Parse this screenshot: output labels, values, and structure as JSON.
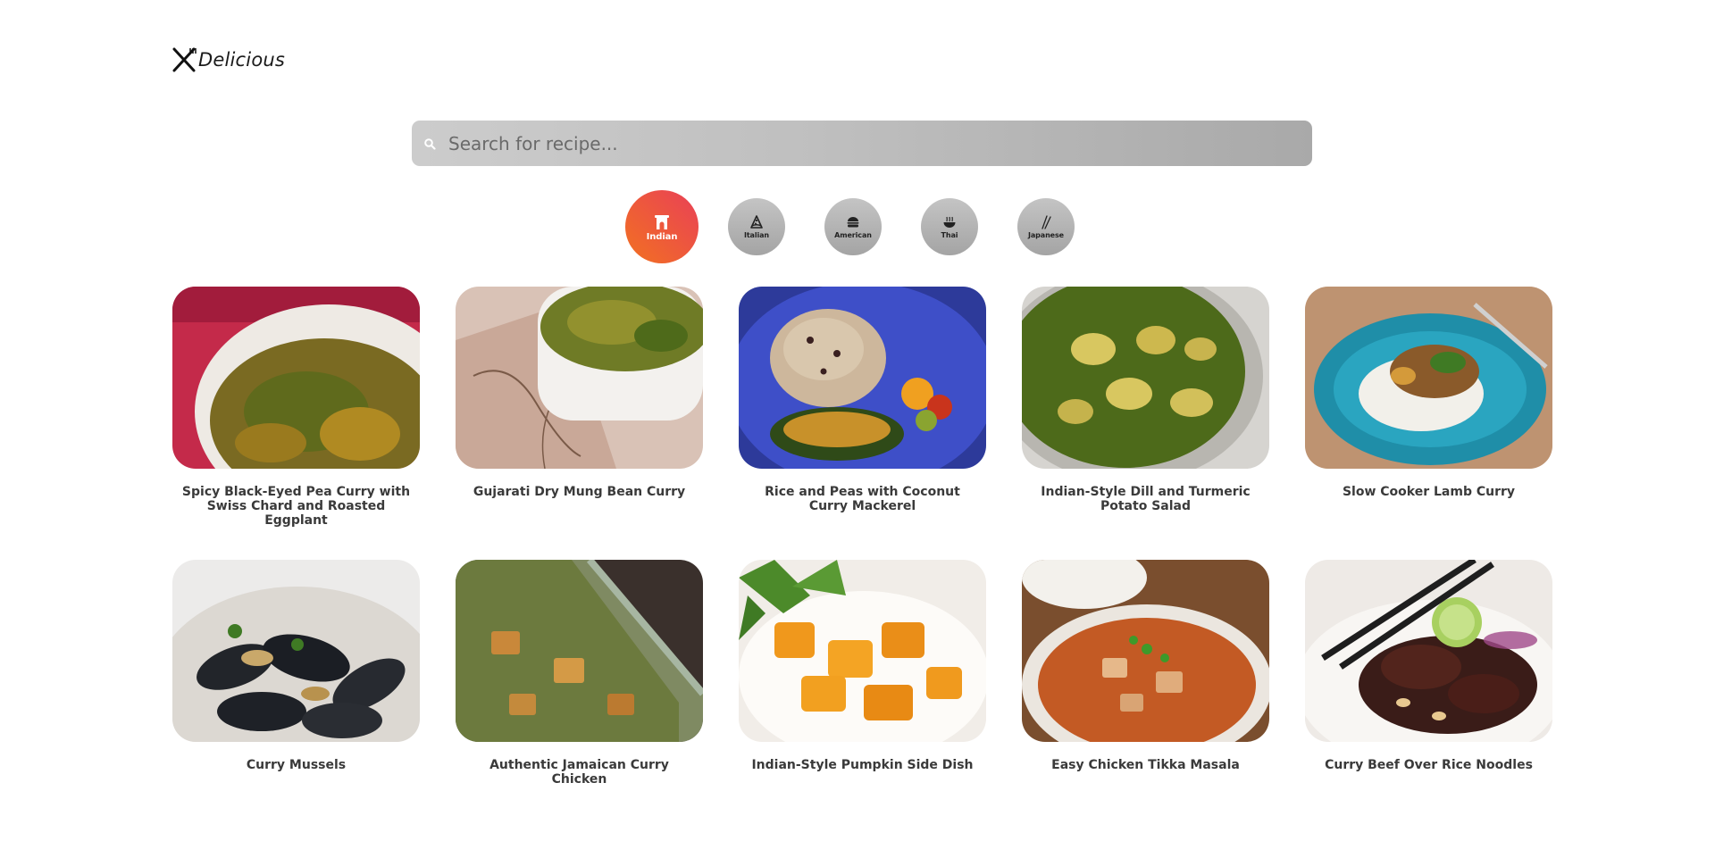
{
  "header": {
    "logo_text": "Delicious",
    "logo_icon": "fork-knife-crossed-icon"
  },
  "search": {
    "placeholder": "Search for recipe...",
    "value": "",
    "icon": "search-icon"
  },
  "categories": [
    {
      "label": "Indian",
      "icon": "india-gate-icon",
      "active": true
    },
    {
      "label": "Italian",
      "icon": "pizza-icon",
      "active": false
    },
    {
      "label": "American",
      "icon": "burger-icon",
      "active": false
    },
    {
      "label": "Thai",
      "icon": "noodle-bowl-icon",
      "active": false
    },
    {
      "label": "Japanese",
      "icon": "chopsticks-icon",
      "active": false
    }
  ],
  "colors": {
    "accent_start": "#f27121",
    "accent_end": "#e94057",
    "inactive_category": "#b4b4b4",
    "title_text": "#3a3a3a"
  },
  "recipes": [
    {
      "title": "Spicy Black-Eyed Pea Curry with Swiss Chard and Roasted Eggplant"
    },
    {
      "title": "Gujarati Dry Mung Bean Curry"
    },
    {
      "title": "Rice and Peas with Coconut Curry Mackerel"
    },
    {
      "title": "Indian-Style Dill and Turmeric Potato Salad"
    },
    {
      "title": "Slow Cooker Lamb Curry"
    },
    {
      "title": "Curry Mussels"
    },
    {
      "title": "Authentic Jamaican Curry Chicken"
    },
    {
      "title": "Indian-Style Pumpkin Side Dish"
    },
    {
      "title": "Easy Chicken Tikka Masala"
    },
    {
      "title": "Curry Beef Over Rice Noodles"
    }
  ]
}
